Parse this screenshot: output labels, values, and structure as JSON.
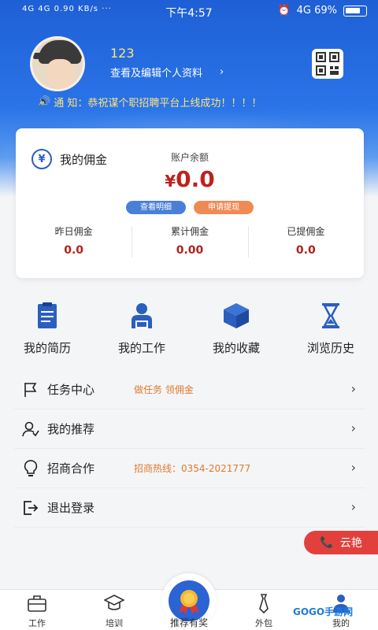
{
  "status_bar": {
    "network": "4G 4G 0.90 KB/s ···",
    "time": "下午4:57",
    "right": "4G 69%"
  },
  "profile": {
    "name": "123",
    "edit_label": "查看及编辑个人资料",
    "chevron": "›"
  },
  "notice": {
    "text": "通 知：恭祝谋个职招聘平台上线成功！！！！"
  },
  "wallet": {
    "title": "我的佣金",
    "balance_label": "账户余额",
    "currency": "¥",
    "balance": "0.0",
    "detail_button": "查看明细",
    "withdraw_button": "申请提现",
    "stats": [
      {
        "label": "昨日佣金",
        "value": "0.0"
      },
      {
        "label": "累计佣金",
        "value": "0.00"
      },
      {
        "label": "已提佣金",
        "value": "0.0"
      }
    ]
  },
  "quick_actions": [
    {
      "label": "我的简历",
      "icon": "resume-icon"
    },
    {
      "label": "我的工作",
      "icon": "work-icon"
    },
    {
      "label": "我的收藏",
      "icon": "favorites-icon"
    },
    {
      "label": "浏览历史",
      "icon": "hourglass-icon"
    }
  ],
  "menu": [
    {
      "label": "任务中心",
      "sub": "做任务 领佣金",
      "icon": "flag-icon"
    },
    {
      "label": "我的推荐",
      "sub": "",
      "icon": "user-recommend-icon"
    },
    {
      "label": "招商合作",
      "sub": "招商热线：0354-2021777",
      "icon": "bulb-icon"
    },
    {
      "label": "退出登录",
      "sub": "",
      "icon": "logout-icon"
    }
  ],
  "contact": {
    "label": "云艳"
  },
  "tabbar": {
    "items": [
      {
        "label": "工作",
        "icon": "briefcase-icon"
      },
      {
        "label": "培训",
        "icon": "graduation-icon"
      },
      {
        "label": "推荐有奖",
        "icon": "medal-icon"
      },
      {
        "label": "外包",
        "icon": "tie-icon"
      },
      {
        "label": "我的",
        "icon": "person-icon"
      }
    ]
  },
  "watermark": "GOGO手游网",
  "colors": {
    "primary": "#2a63d4",
    "accent_red": "#c0201c",
    "notice_yellow": "#ffe37a",
    "orange": "#f08a55"
  }
}
